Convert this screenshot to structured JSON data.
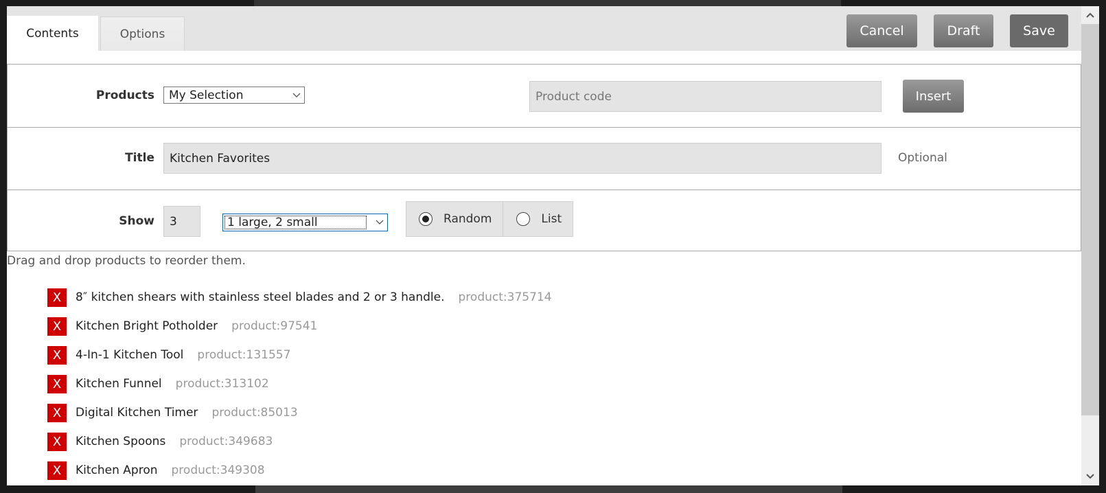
{
  "tabs": [
    {
      "label": "Contents",
      "active": true
    },
    {
      "label": "Options",
      "active": false
    }
  ],
  "header_buttons": {
    "cancel": "Cancel",
    "draft": "Draft",
    "save": "Save"
  },
  "form": {
    "products": {
      "label": "Products",
      "selected": "My Selection",
      "code_placeholder": "Product code",
      "insert_label": "Insert"
    },
    "title": {
      "label": "Title",
      "value": "Kitchen Favorites",
      "hint": "Optional"
    },
    "show": {
      "label": "Show",
      "count": "3",
      "layout_selected": "1 large, 2 small",
      "radio_options": [
        {
          "label": "Random",
          "checked": true
        },
        {
          "label": "List",
          "checked": false
        }
      ]
    }
  },
  "hint": "Drag and drop products to reorder them.",
  "remove_icon_label": "X",
  "products": [
    {
      "name": "8″ kitchen shears with stainless steel blades and 2 or 3 handle.",
      "code": "product:375714"
    },
    {
      "name": "Kitchen Bright Potholder",
      "code": "product:97541"
    },
    {
      "name": "4-In-1 Kitchen Tool",
      "code": "product:131557"
    },
    {
      "name": "Kitchen Funnel",
      "code": "product:313102"
    },
    {
      "name": "Digital Kitchen Timer",
      "code": "product:85013"
    },
    {
      "name": "Kitchen Spoons",
      "code": "product:349683"
    },
    {
      "name": "Kitchen Apron",
      "code": "product:349308"
    }
  ],
  "colors": {
    "remove_red": "#d00000",
    "button_gray": "#6c6c6c",
    "header_bg": "#e4e4e4"
  }
}
